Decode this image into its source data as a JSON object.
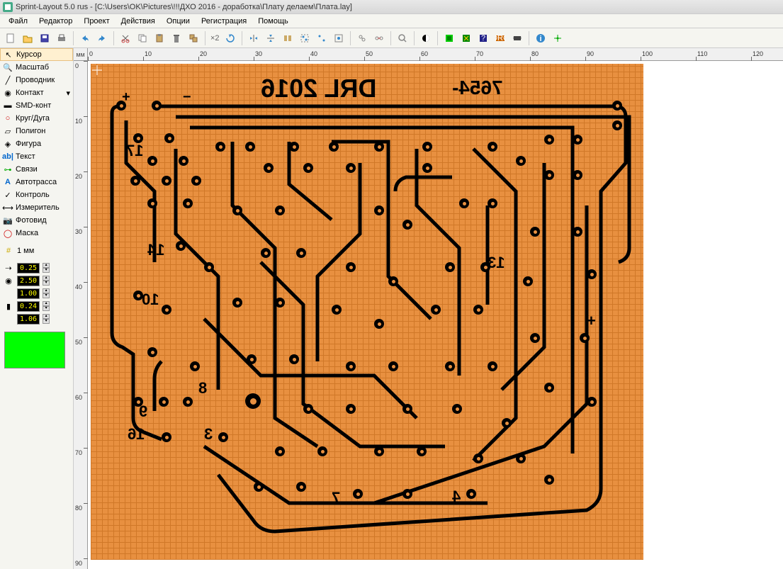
{
  "title": "Sprint-Layout 5.0 rus    - [C:\\Users\\OK\\Pictures\\!!!ДХО 2016 - доработка\\Плату делаем\\Плата.lay]",
  "menus": [
    "Файл",
    "Редактор",
    "Проект",
    "Действия",
    "Опции",
    "Регистрация",
    "Помощь"
  ],
  "tools": [
    {
      "label": "Курсор",
      "icon": "cursor",
      "selected": true
    },
    {
      "label": "Масштаб",
      "icon": "zoom"
    },
    {
      "label": "Проводник",
      "icon": "track"
    },
    {
      "label": "Контакт",
      "icon": "pad",
      "dropdown": true
    },
    {
      "label": "SMD-конт",
      "icon": "smd"
    },
    {
      "label": "Круг/Дуга",
      "icon": "circle"
    },
    {
      "label": "Полигон",
      "icon": "polygon"
    },
    {
      "label": "Фигура",
      "icon": "shape"
    },
    {
      "label": "Текст",
      "icon": "text"
    },
    {
      "label": "Связи",
      "icon": "link"
    },
    {
      "label": "Автотрасса",
      "icon": "auto"
    },
    {
      "label": "Контроль",
      "icon": "check"
    },
    {
      "label": "Измеритель",
      "icon": "measure"
    },
    {
      "label": "Фотовид",
      "icon": "photo"
    },
    {
      "label": "Маска",
      "icon": "mask"
    }
  ],
  "grid_unit": "1 мм",
  "params": {
    "track_width": "0.25",
    "pad_outer": "2.50",
    "pad_inner": "1.00",
    "via_outer": "0.24",
    "via_inner": "1.06"
  },
  "ruler_unit": "мм",
  "ruler_h": [
    "0",
    "10",
    "20",
    "30",
    "40",
    "50",
    "60",
    "70",
    "80",
    "90",
    "100",
    "110",
    "120"
  ],
  "ruler_v": [
    "0",
    "10",
    "20",
    "30",
    "40",
    "50",
    "60",
    "70",
    "80",
    "90"
  ],
  "zoom_label": "×2",
  "pcb_texts": {
    "main": "DRL 2016",
    "sub": "7654-",
    "n17": "17",
    "n14": "14",
    "n13": "13",
    "n10": "10",
    "n8": "8",
    "n9": "9",
    "n16": "16",
    "n3": "3",
    "n7": "7",
    "n4": "4",
    "plus": "+",
    "minus": "−"
  }
}
